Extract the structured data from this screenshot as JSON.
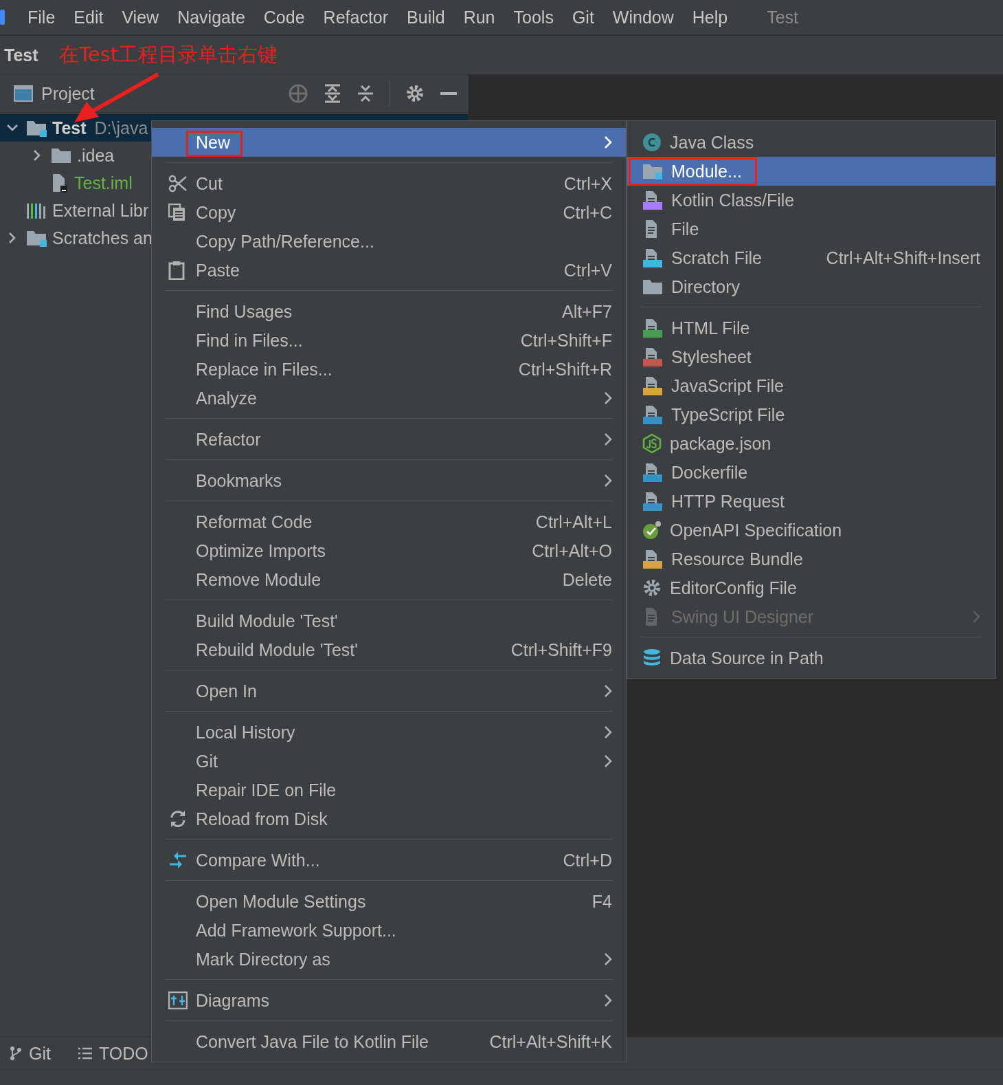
{
  "menubar": {
    "items": [
      "File",
      "Edit",
      "View",
      "Navigate",
      "Code",
      "Refactor",
      "Build",
      "Run",
      "Tools",
      "Git",
      "Window",
      "Help"
    ],
    "project_title": "Test"
  },
  "title_bar": {
    "project": "Test",
    "annotation": "在Test工程目录单击右键"
  },
  "project_panel": {
    "title": "Project",
    "tree": [
      {
        "label": "Test",
        "path": "D:\\java",
        "selected": true,
        "expanded": true,
        "color": "#d0d0d0",
        "children": [
          {
            "label": ".idea",
            "selected": false,
            "expanded": false,
            "color": "#bbbbbb"
          },
          {
            "label": "Test.iml",
            "selected": false,
            "color": "#62b543"
          }
        ]
      },
      {
        "label": "External Libr",
        "selected": false,
        "color": "#bbbbbb"
      },
      {
        "label": "Scratches an",
        "selected": false,
        "expanded": false,
        "color": "#bbbbbb"
      }
    ]
  },
  "context_menu": {
    "groups": [
      [
        {
          "label": "New",
          "selected": true,
          "submenu": true,
          "annotated": true
        }
      ],
      [
        {
          "label": "Cut",
          "shortcut": "Ctrl+X",
          "selected": false
        },
        {
          "label": "Copy",
          "shortcut": "Ctrl+C",
          "selected": false
        },
        {
          "label": "Copy Path/Reference...",
          "selected": false
        },
        {
          "label": "Paste",
          "shortcut": "Ctrl+V",
          "selected": false
        }
      ],
      [
        {
          "label": "Find Usages",
          "shortcut": "Alt+F7",
          "selected": false
        },
        {
          "label": "Find in Files...",
          "shortcut": "Ctrl+Shift+F",
          "selected": false
        },
        {
          "label": "Replace in Files...",
          "shortcut": "Ctrl+Shift+R",
          "selected": false
        },
        {
          "label": "Analyze",
          "submenu": true,
          "selected": false
        }
      ],
      [
        {
          "label": "Refactor",
          "submenu": true,
          "selected": false
        }
      ],
      [
        {
          "label": "Bookmarks",
          "submenu": true,
          "selected": false
        }
      ],
      [
        {
          "label": "Reformat Code",
          "shortcut": "Ctrl+Alt+L",
          "selected": false
        },
        {
          "label": "Optimize Imports",
          "shortcut": "Ctrl+Alt+O",
          "selected": false
        },
        {
          "label": "Remove Module",
          "shortcut": "Delete",
          "selected": false
        }
      ],
      [
        {
          "label": "Build Module 'Test'",
          "selected": false
        },
        {
          "label": "Rebuild Module 'Test'",
          "shortcut": "Ctrl+Shift+F9",
          "selected": false
        }
      ],
      [
        {
          "label": "Open In",
          "submenu": true,
          "selected": false
        }
      ],
      [
        {
          "label": "Local History",
          "submenu": true,
          "selected": false
        },
        {
          "label": "Git",
          "submenu": true,
          "selected": false
        },
        {
          "label": "Repair IDE on File",
          "selected": false
        },
        {
          "label": "Reload from Disk",
          "selected": false
        }
      ],
      [
        {
          "label": "Compare With...",
          "shortcut": "Ctrl+D",
          "selected": false
        }
      ],
      [
        {
          "label": "Open Module Settings",
          "shortcut": "F4",
          "selected": false
        },
        {
          "label": "Add Framework Support...",
          "selected": false
        },
        {
          "label": "Mark Directory as",
          "submenu": true,
          "selected": false
        }
      ],
      [
        {
          "label": "Diagrams",
          "submenu": true,
          "selected": false
        }
      ],
      [
        {
          "label": "Convert Java File to Kotlin File",
          "shortcut": "Ctrl+Alt+Shift+K",
          "selected": false
        }
      ]
    ]
  },
  "new_submenu": {
    "groups": [
      [
        {
          "label": "Java Class",
          "selected": false
        },
        {
          "label": "Module...",
          "selected": true,
          "annotated": true
        },
        {
          "label": "Kotlin Class/File",
          "selected": false
        },
        {
          "label": "File",
          "selected": false
        },
        {
          "label": "Scratch File",
          "shortcut": "Ctrl+Alt+Shift+Insert",
          "selected": false
        },
        {
          "label": "Directory",
          "selected": false
        }
      ],
      [
        {
          "label": "HTML File",
          "selected": false
        },
        {
          "label": "Stylesheet",
          "selected": false
        },
        {
          "label": "JavaScript File",
          "selected": false
        },
        {
          "label": "TypeScript File",
          "selected": false
        },
        {
          "label": "package.json",
          "selected": false
        },
        {
          "label": "Dockerfile",
          "selected": false
        },
        {
          "label": "HTTP Request",
          "selected": false
        },
        {
          "label": "OpenAPI Specification",
          "selected": false
        },
        {
          "label": "Resource Bundle",
          "selected": false
        },
        {
          "label": "EditorConfig File",
          "selected": false
        },
        {
          "label": "Swing UI Designer",
          "selected": false,
          "disabled": true,
          "submenu": true
        }
      ],
      [
        {
          "label": "Data Source in Path",
          "selected": false
        }
      ]
    ]
  },
  "tool_window_bar": {
    "items": [
      "Git",
      "TODO"
    ]
  }
}
